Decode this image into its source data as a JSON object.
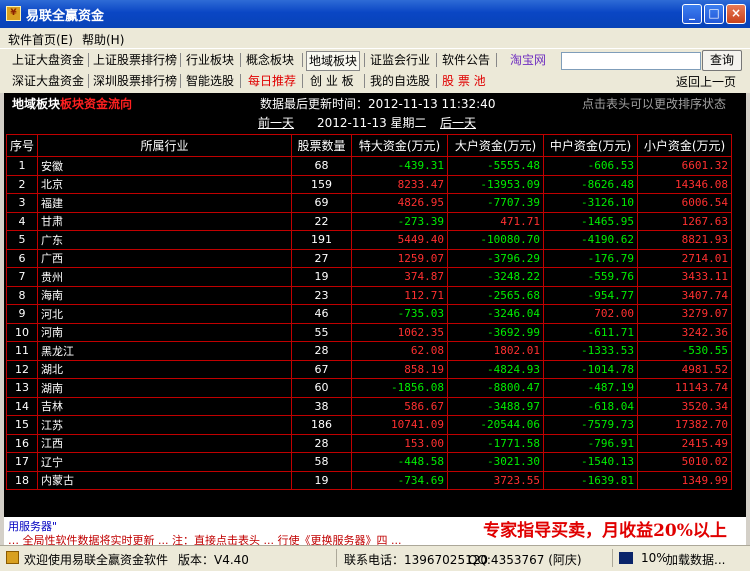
{
  "window": {
    "title": "易联全赢资金"
  },
  "menu": [
    {
      "label": "软件首页(E)"
    },
    {
      "label": "帮助(H)"
    }
  ],
  "toolbar": {
    "row1": [
      "上证大盘资金",
      "上证股票排行榜",
      "行业板块",
      "概念板块",
      "地域板块",
      "证监会行业",
      "软件公告",
      "淘宝网"
    ],
    "row2": [
      "深证大盘资金",
      "深圳股票排行榜",
      "智能选股",
      "每日推荐",
      "创 业 板",
      "我的自选股",
      "股 票 池"
    ],
    "search_value": "",
    "search_button": "查询",
    "back": "返回上一页"
  },
  "panel": {
    "title_prefix": "地域板块",
    "title_suffix": "板块资金流向",
    "update_time": "数据最后更新时间：2012-11-13 11:32:40",
    "sort_hint": "点击表头可以更改排序状态",
    "prev_day": "前一天",
    "current_date": "2012-11-13 星期二",
    "next_day": "后一天"
  },
  "table": {
    "headers": [
      "序号",
      "所属行业",
      "股票数量",
      "特大资金(万元)",
      "大户资金(万元)",
      "中户资金(万元)",
      "小户资金(万元)"
    ],
    "rows": [
      [
        "1",
        "安徽",
        "68",
        "-439.31",
        "-5555.48",
        "-606.53",
        "6601.32"
      ],
      [
        "2",
        "北京",
        "159",
        "8233.47",
        "-13953.09",
        "-8626.48",
        "14346.08"
      ],
      [
        "3",
        "福建",
        "69",
        "4826.95",
        "-7707.39",
        "-3126.10",
        "6006.54"
      ],
      [
        "4",
        "甘肃",
        "22",
        "-273.39",
        "471.71",
        "-1465.95",
        "1267.63"
      ],
      [
        "5",
        "广东",
        "191",
        "5449.40",
        "-10080.70",
        "-4190.62",
        "8821.93"
      ],
      [
        "6",
        "广西",
        "27",
        "1259.07",
        "-3796.29",
        "-176.79",
        "2714.01"
      ],
      [
        "7",
        "贵州",
        "19",
        "374.87",
        "-3248.22",
        "-559.76",
        "3433.11"
      ],
      [
        "8",
        "海南",
        "23",
        "112.71",
        "-2565.68",
        "-954.77",
        "3407.74"
      ],
      [
        "9",
        "河北",
        "46",
        "-735.03",
        "-3246.04",
        "702.00",
        "3279.07"
      ],
      [
        "10",
        "河南",
        "55",
        "1062.35",
        "-3692.99",
        "-611.71",
        "3242.36"
      ],
      [
        "11",
        "黑龙江",
        "28",
        "62.08",
        "1802.01",
        "-1333.53",
        "-530.55"
      ],
      [
        "12",
        "湖北",
        "67",
        "858.19",
        "-4824.93",
        "-1014.78",
        "4981.52"
      ],
      [
        "13",
        "湖南",
        "60",
        "-1856.08",
        "-8800.47",
        "-487.19",
        "11143.74"
      ],
      [
        "14",
        "吉林",
        "38",
        "586.67",
        "-3488.97",
        "-618.04",
        "3520.34"
      ],
      [
        "15",
        "江苏",
        "186",
        "10741.09",
        "-20544.06",
        "-7579.73",
        "17382.70"
      ],
      [
        "16",
        "江西",
        "28",
        "153.00",
        "-1771.58",
        "-796.91",
        "2415.49"
      ],
      [
        "17",
        "辽宁",
        "58",
        "-448.58",
        "-3021.30",
        "-1540.13",
        "5010.02"
      ],
      [
        "18",
        "内蒙古",
        "19",
        "-734.69",
        "3723.55",
        "-1639.81",
        "1349.99"
      ]
    ]
  },
  "ticker": {
    "line1": "用服务器\"",
    "line2": "… 全局性软件数据将实时更新 ... 注：直接点击表头 ... 行使《更换服务器》四 ..."
  },
  "ad": "专家指导买卖，月收益20%以上",
  "status": {
    "welcome": "欢迎使用易联全赢资金软件",
    "version": "版本：V4.40",
    "phone": "联系电话：13967025120",
    "qq": "QQ:4353767 (阿庆)",
    "progress": "10%",
    "loading": "加载数据..."
  },
  "colors": {
    "positive": "#ff3030",
    "negative": "#00ee00",
    "grid": "#c00000",
    "titlebar": "#0a46c4"
  }
}
